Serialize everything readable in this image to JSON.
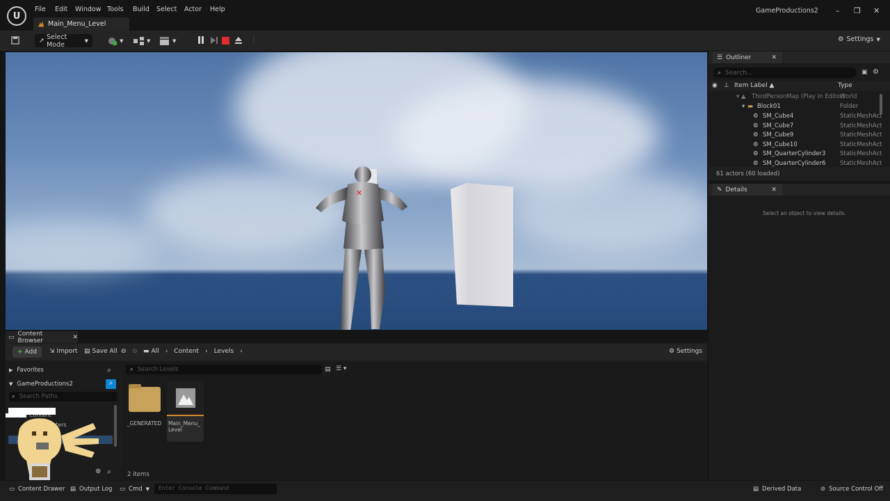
{
  "menu": [
    "File",
    "Edit",
    "Window",
    "Tools",
    "Build",
    "Select",
    "Actor",
    "Help"
  ],
  "level_tab": "Main_Menu_Level",
  "project_name": "GameProductions2",
  "toolbar": {
    "select_mode": "Select Mode",
    "settings": "Settings"
  },
  "outliner": {
    "title": "Outliner",
    "search_placeholder": "Search...",
    "col_label": "Item Label ▲",
    "col_type": "Type",
    "rows": [
      {
        "label": "ThirdPersonMap (Play In Editor)",
        "type": "World"
      },
      {
        "label": "Block01",
        "type": "Folder"
      },
      {
        "label": "SM_Cube4",
        "type": "StaticMeshAct"
      },
      {
        "label": "SM_Cube7",
        "type": "StaticMeshAct"
      },
      {
        "label": "SM_Cube9",
        "type": "StaticMeshAct"
      },
      {
        "label": "SM_Cube10",
        "type": "StaticMeshAct"
      },
      {
        "label": "SM_QuarterCylinder3",
        "type": "StaticMeshAct"
      },
      {
        "label": "SM_QuarterCylinder6",
        "type": "StaticMeshAct"
      }
    ],
    "actors_count": "61 actors (60 loaded)"
  },
  "details": {
    "title": "Details",
    "empty_text": "Select an object to view details."
  },
  "content_browser": {
    "tab": "Content Browser",
    "add": "Add",
    "import": "Import",
    "save_all": "Save All",
    "breadcrumb": [
      "All",
      "Content",
      "Levels"
    ],
    "settings": "Settings",
    "favorites": "Favorites",
    "project": "GameProductions2",
    "path_search_placeholder": "Search Paths",
    "asset_search_placeholder": "Search Levels",
    "folder_content": "Content",
    "folder_characters": "Characters",
    "assets": [
      {
        "name": "_GENERATED"
      },
      {
        "name": "Main_Menu_ Level"
      }
    ],
    "items_count": "2 items"
  },
  "statusbar": {
    "content_drawer": "Content Drawer",
    "output_log": "Output Log",
    "cmd": "Cmd",
    "console_placeholder": "Enter Console Command",
    "derived_data": "Derived Data",
    "source_control": "Source Control Off"
  },
  "colors": {
    "accent": "#0e86d4",
    "stop": "#e02d2d",
    "folder": "#c8a15a",
    "level": "#d28a2d"
  }
}
